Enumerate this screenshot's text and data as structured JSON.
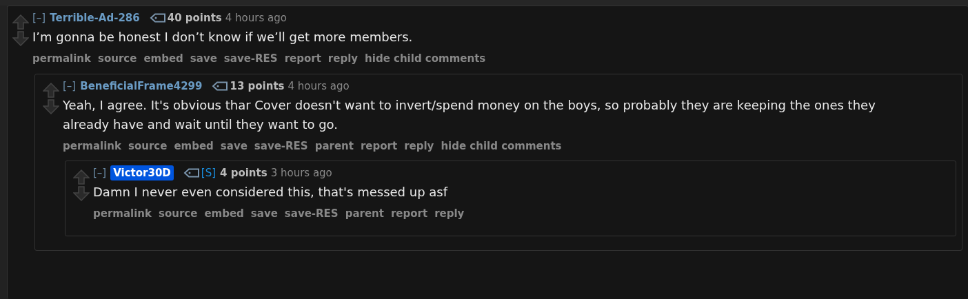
{
  "comment": {
    "collapse": "[–]",
    "author": "Terrible-Ad-286",
    "submitter": false,
    "points": "40 points",
    "time": "4 hours ago",
    "body": "I’m gonna be honest I don’t know if we’ll get more members.",
    "actions": [
      "permalink",
      "source",
      "embed",
      "save",
      "save-RES",
      "report",
      "reply",
      "hide child comments"
    ],
    "children": [
      {
        "collapse": "[–]",
        "author": "BeneficialFrame4299",
        "submitter": false,
        "points": "13 points",
        "time": "4 hours ago",
        "body": "Yeah, I agree. It's obvious thar Cover doesn't want to invert/spend money on the boys, so probably they are keeping the ones they already have and wait until they want to go.",
        "actions": [
          "permalink",
          "source",
          "embed",
          "save",
          "save-RES",
          "parent",
          "report",
          "reply",
          "hide child comments"
        ],
        "children": [
          {
            "collapse": "[–]",
            "author": "Victor30D",
            "submitter": true,
            "flair": "[S]",
            "points": "4 points",
            "time": "3 hours ago",
            "body": "Damn I never even considered this, that's messed up asf",
            "actions": [
              "permalink",
              "source",
              "embed",
              "save",
              "save-RES",
              "parent",
              "report",
              "reply"
            ]
          }
        ]
      }
    ]
  }
}
